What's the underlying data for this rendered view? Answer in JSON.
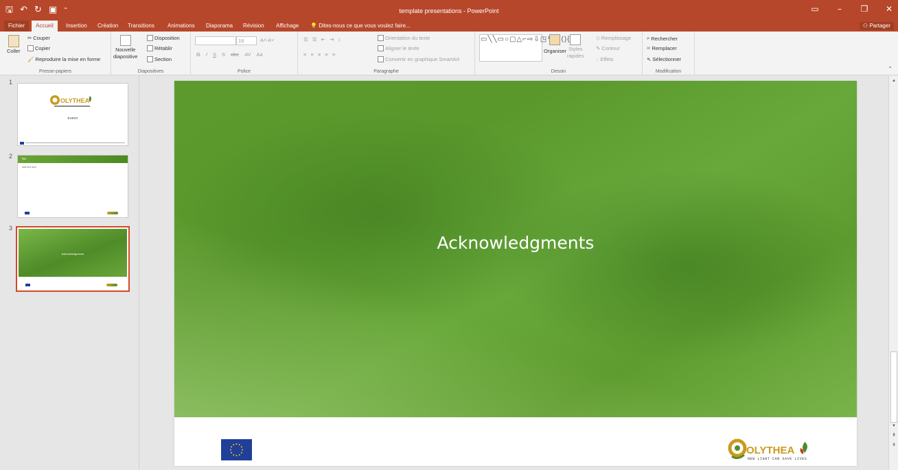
{
  "window": {
    "title": "template presentations - PowerPoint",
    "qat": [
      "save-icon",
      "undo-icon",
      "redo-icon",
      "start-from-beginning-icon",
      "customize-icon"
    ],
    "controls": [
      "ribbon-display-icon",
      "minimize-icon",
      "restore-icon",
      "close-icon"
    ]
  },
  "tabs": {
    "file": "Fichier",
    "home": "Accueil",
    "insert": "Insertion",
    "design": "Création",
    "transitions": "Transitions",
    "animations": "Animations",
    "slideshow": "Diaporama",
    "review": "Révision",
    "view": "Affichage",
    "tellme": "Dites-nous ce que vous voulez faire...",
    "share": "Partager"
  },
  "ribbon": {
    "clipboard": {
      "paste": "Coller",
      "cut": "Couper",
      "copy": "Copier",
      "format_painter": "Reproduire la mise en forme",
      "label": "Presse-papiers"
    },
    "slides": {
      "new_slide_line1": "Nouvelle",
      "new_slide_line2": "diapositive",
      "layout": "Disposition",
      "reset": "Rétablir",
      "section": "Section",
      "label": "Diapositives"
    },
    "font": {
      "font_size": "18",
      "bold": "G",
      "italic": "I",
      "underline": "S",
      "shadow": "S",
      "strike": "abc",
      "spacing": "AV",
      "case": "Aa",
      "label": "Police"
    },
    "paragraph": {
      "text_direction": "Orientation du texte",
      "align_text": "Aligner le texte",
      "smartart": "Convertir en graphique SmartArt",
      "label": "Paragraphe"
    },
    "drawing": {
      "arrange": "Organiser",
      "quick_styles_line1": "Styles",
      "quick_styles_line2": "rapides",
      "fill": "Remplissage",
      "outline": "Contour",
      "effects": "Effets",
      "label": "Dessin"
    },
    "editing": {
      "find": "Rechercher",
      "replace": "Remplacer",
      "select": "Sélectionner",
      "label": "Modification"
    }
  },
  "thumbnails": [
    {
      "number": "1",
      "logo_text": "OLYTHEA",
      "event": "EVENT"
    },
    {
      "number": "2",
      "title": "Title",
      "sub": "Add text here"
    },
    {
      "number": "3",
      "title": "Acknowledgments",
      "selected": true
    }
  ],
  "slide": {
    "title": "Acknowledgments",
    "logo_text": "OLYTHEA",
    "logo_tagline": "NEW LIGHT CAN SAVE LIVES"
  },
  "colors": {
    "accent": "#b7472a",
    "slide_green": "#5c9a2e",
    "eu_blue": "#1f3f99"
  }
}
